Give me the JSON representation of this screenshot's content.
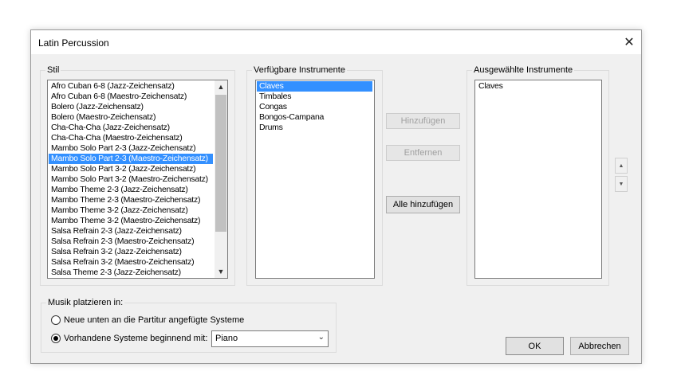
{
  "window": {
    "title": "Latin Percussion",
    "close_glyph": "✕"
  },
  "stil": {
    "label": "Stil",
    "items": [
      "Afro Cuban 6-8 (Jazz-Zeichensatz)",
      "Afro Cuban 6-8 (Maestro-Zeichensatz)",
      "Bolero (Jazz-Zeichensatz)",
      "Bolero (Maestro-Zeichensatz)",
      "Cha-Cha-Cha (Jazz-Zeichensatz)",
      "Cha-Cha-Cha (Maestro-Zeichensatz)",
      "Mambo Solo Part 2-3 (Jazz-Zeichensatz)",
      "Mambo Solo Part 2-3 (Maestro-Zeichensatz)",
      "Mambo Solo Part 3-2 (Jazz-Zeichensatz)",
      "Mambo Solo Part 3-2 (Maestro-Zeichensatz)",
      "Mambo Theme 2-3 (Jazz-Zeichensatz)",
      "Mambo Theme 2-3 (Maestro-Zeichensatz)",
      "Mambo Theme 3-2 (Jazz-Zeichensatz)",
      "Mambo Theme 3-2 (Maestro-Zeichensatz)",
      "Salsa Refrain 2-3 (Jazz-Zeichensatz)",
      "Salsa Refrain 2-3 (Maestro-Zeichensatz)",
      "Salsa Refrain 3-2 (Jazz-Zeichensatz)",
      "Salsa Refrain 3-2 (Maestro-Zeichensatz)",
      "Salsa Theme 2-3 (Jazz-Zeichensatz)"
    ],
    "selected_index": 7
  },
  "verfuegbar": {
    "label": "Verfügbare Instrumente",
    "items": [
      "Claves",
      "Timbales",
      "Congas",
      "Bongos-Campana",
      "Drums"
    ],
    "selected_index": 0
  },
  "ausgewaehlt": {
    "label": "Ausgewählte Instrumente",
    "items": [
      "Claves"
    ]
  },
  "buttons": {
    "hinzufuegen": "Hinzufügen",
    "entfernen": "Entfernen",
    "alle_hinzufuegen": "Alle hinzufügen",
    "ok": "OK",
    "abbrechen": "Abbrechen"
  },
  "musik": {
    "label": "Musik platzieren in:",
    "option_new": "Neue unten an die Partitur angefügte Systeme",
    "option_existing": "Vorhandene Systeme beginnend mit:",
    "selected_option": "existing",
    "combo_value": "Piano"
  },
  "icons": {
    "scroll_up": "▲",
    "scroll_down": "▼",
    "move_up": "▲",
    "move_down": "▼",
    "combo_arrow": "⌄"
  }
}
